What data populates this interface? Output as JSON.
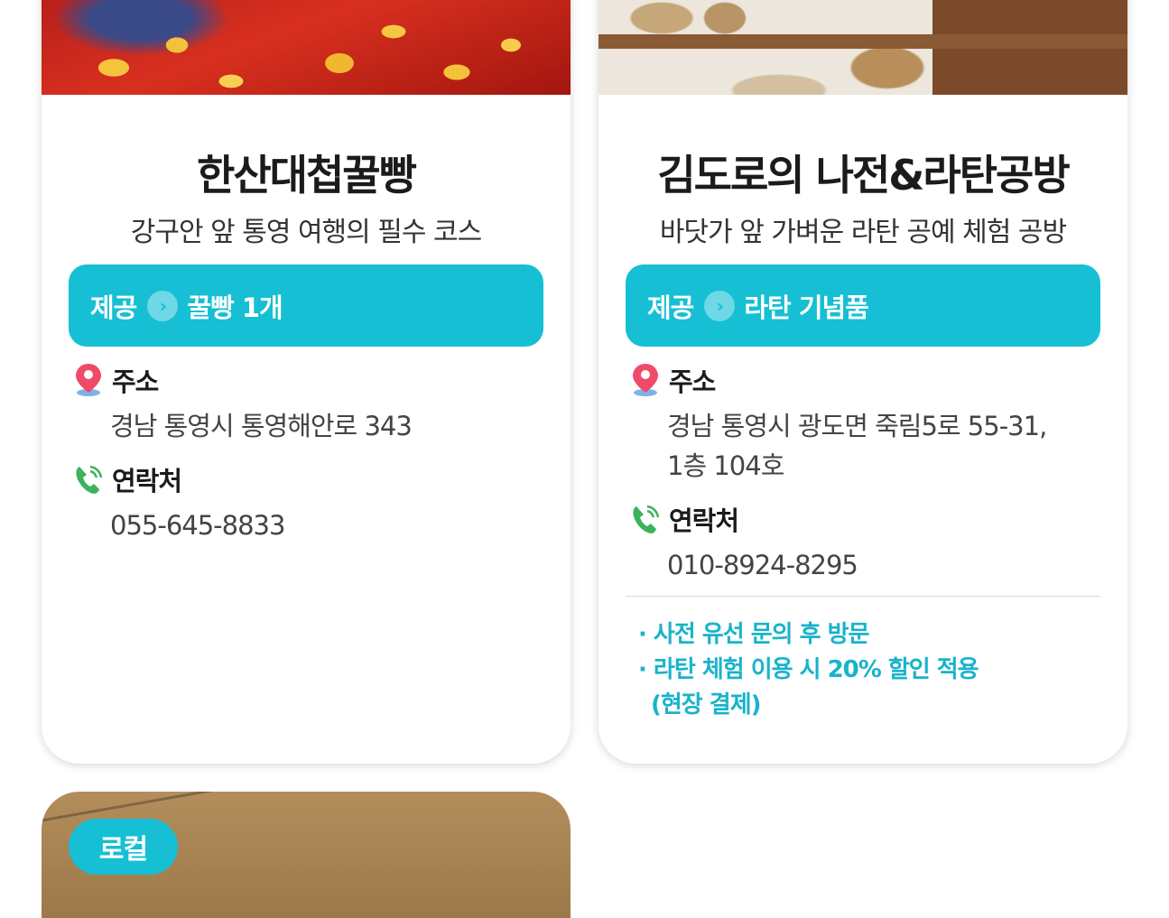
{
  "cards": [
    {
      "title": "한산대첩꿀빵",
      "subtitle": "강구안 앞 통영 여행의 필수 코스",
      "provide_label": "제공",
      "provide_item": "꿀빵 1개",
      "address_label": "주소",
      "address_lines": [
        "경남 통영시 통영해안로 343"
      ],
      "contact_label": "연락처",
      "phone": "055-645-8833",
      "notes": []
    },
    {
      "title": "김도로의 나전&라탄공방",
      "subtitle": "바닷가 앞 가벼운 라탄 공예 체험 공방",
      "provide_label": "제공",
      "provide_item": "라탄 기념품",
      "address_label": "주소",
      "address_lines": [
        "경남 통영시 광도면 죽림5로 55-31,",
        "1층 104호"
      ],
      "contact_label": "연락처",
      "phone": "010-8924-8295",
      "notes": [
        "· 사전 유선 문의 후 방문",
        "· 라탄 체험 이용 시 20% 할인 적용",
        "(현장 결제)"
      ]
    },
    {
      "badge": "로컬"
    }
  ],
  "colors": {
    "accent": "#16bfd4",
    "note_text": "#19b3cb"
  },
  "icons": {
    "arrow": "chevron-right-icon",
    "address": "map-pin-icon",
    "contact": "phone-icon"
  }
}
